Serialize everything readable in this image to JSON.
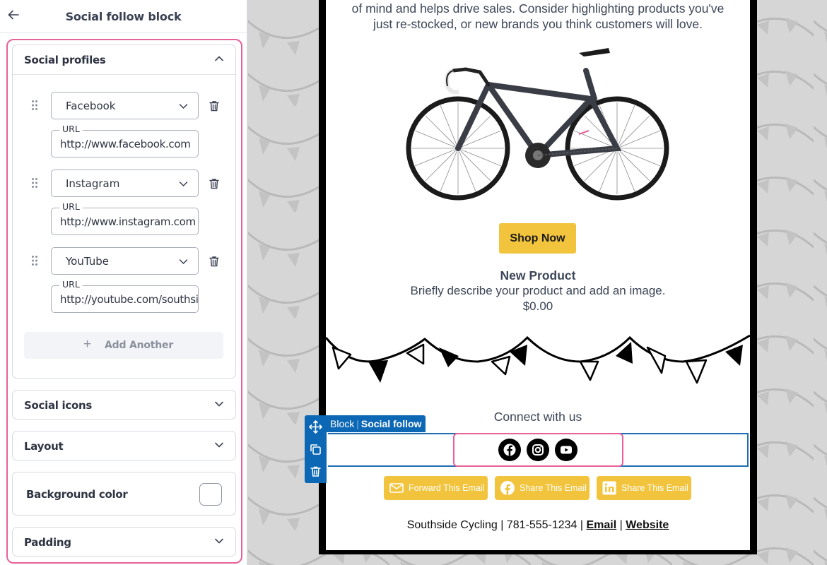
{
  "panel": {
    "title": "Social follow block",
    "sections": {
      "profiles": "Social profiles",
      "icons": "Social icons",
      "layout": "Layout",
      "background": "Background color",
      "padding": "Padding"
    },
    "profiles": [
      {
        "network": "Facebook",
        "url_label": "URL",
        "url": "http://www.facebook.com"
      },
      {
        "network": "Instagram",
        "url_label": "URL",
        "url": "http://www.instagram.com"
      },
      {
        "network": "YouTube",
        "url_label": "URL",
        "url": "http://youtube.com/southsidecycling"
      }
    ],
    "add_another": "Add Another",
    "background_color": "#ffffff"
  },
  "email": {
    "intro_line1": "of mind and helps drive sales. Consider highlighting products you've",
    "intro_line2": "just re-stocked, or new brands you think customers will love.",
    "shop_now": "Shop Now",
    "product_name": "New Product",
    "product_desc": "Briefly describe your product and add an image.",
    "product_price": "$0.00",
    "connect": "Connect with us",
    "block_tag_prefix": "Block",
    "block_tag_name": "Social follow",
    "share_buttons": [
      "Forward This Email",
      "Share This Email",
      "Share This Email"
    ],
    "footer_text": "Southside Cycling | 781-555-1234 | ",
    "footer_email": "Email",
    "footer_sep": " | ",
    "footer_website": "Website"
  },
  "colors": {
    "accent_pink": "#e8619b",
    "button_yellow": "#f2c43d",
    "block_blue": "#0c67b5"
  },
  "icons": [
    "back-arrow-icon",
    "chevron-up-icon",
    "chevron-down-icon",
    "drag-handle-icon",
    "trash-icon",
    "plus-icon",
    "move-icon",
    "duplicate-icon",
    "facebook-icon",
    "instagram-icon",
    "youtube-icon",
    "envelope-icon",
    "linkedin-icon"
  ]
}
